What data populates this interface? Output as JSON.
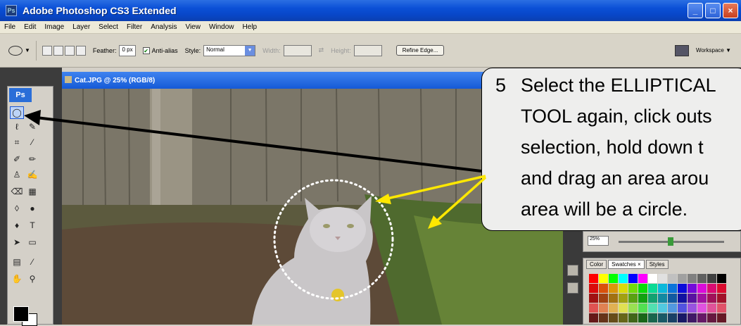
{
  "window": {
    "title": "Adobe Photoshop CS3 Extended",
    "app_icon": "Ps",
    "buttons": [
      "minimize",
      "maximize",
      "close"
    ]
  },
  "menu": [
    "File",
    "Edit",
    "Image",
    "Layer",
    "Select",
    "Filter",
    "Analysis",
    "View",
    "Window",
    "Help"
  ],
  "options": {
    "feather_label": "Feather:",
    "feather_value": "0 px",
    "antialias_label": "Anti-alias",
    "antialias_checked": true,
    "style_label": "Style:",
    "style_value": "Normal",
    "width_label": "Width:",
    "height_label": "Height:",
    "refine_button": "Refine Edge...",
    "workspace_label": "Workspace ▼"
  },
  "toolbox": {
    "logo": "Ps"
  },
  "document": {
    "title": "Cat.JPG @ 25% (RGB/8)"
  },
  "panels": {
    "zoom_value": "25%",
    "swatch_tabs": [
      "Color",
      "Swatches ×",
      "Styles"
    ]
  },
  "callout": {
    "number": "5",
    "lines": [
      "Select the ELLIPTICAL",
      "TOOL again, click outs",
      "selection, hold down t",
      "and drag an area arou",
      "area will be a circle."
    ]
  },
  "colors": {
    "title_bar": "#0a4fd6",
    "arrow_yellow": "#ffee00",
    "arrow_black": "#000000"
  }
}
